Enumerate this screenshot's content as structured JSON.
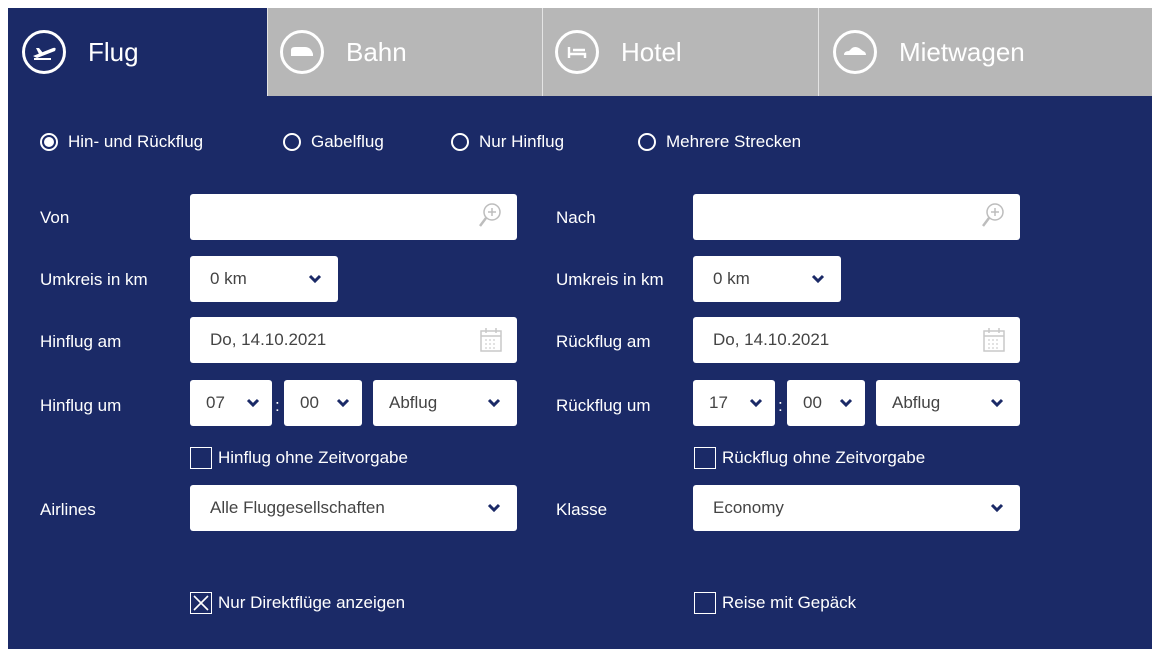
{
  "tabs": [
    {
      "label": "Flug",
      "icon": "plane-icon",
      "active": true
    },
    {
      "label": "Bahn",
      "icon": "train-icon",
      "active": false
    },
    {
      "label": "Hotel",
      "icon": "bed-icon",
      "active": false
    },
    {
      "label": "Mietwagen",
      "icon": "car-icon",
      "active": false
    }
  ],
  "trip_types": [
    {
      "label": "Hin- und Rückflug",
      "checked": true
    },
    {
      "label": "Gabelflug",
      "checked": false
    },
    {
      "label": "Nur Hinflug",
      "checked": false
    },
    {
      "label": "Mehrere Strecken",
      "checked": false
    }
  ],
  "left": {
    "from_label": "Von",
    "from_value": "",
    "radius_label": "Umkreis in km",
    "radius_value": "0 km",
    "date_label": "Hinflug am",
    "date_value": "Do, 14.10.2021",
    "time_label": "Hinflug um",
    "hour_value": "07",
    "minute_value": "00",
    "time_mode_value": "Abflug",
    "no_time_label": "Hinflug ohne Zeitvorgabe",
    "no_time_checked": false,
    "airlines_label": "Airlines",
    "airlines_value": "Alle Fluggesellschaften",
    "direct_label": "Nur Direktflüge anzeigen",
    "direct_checked": true
  },
  "right": {
    "to_label": "Nach",
    "to_value": "",
    "radius_label": "Umkreis in km",
    "radius_value": "0 km",
    "date_label": "Rückflug am",
    "date_value": "Do, 14.10.2021",
    "time_label": "Rückflug um",
    "hour_value": "17",
    "minute_value": "00",
    "time_mode_value": "Abflug",
    "no_time_label": "Rückflug ohne Zeitvorgabe",
    "no_time_checked": false,
    "class_label": "Klasse",
    "class_value": "Economy",
    "baggage_label": "Reise mit Gepäck",
    "baggage_checked": false
  },
  "time_separator": ":",
  "colors": {
    "panel": "#1b2a67",
    "tab_inactive": "#b7b7b7",
    "chevron": "#1b2a67"
  }
}
